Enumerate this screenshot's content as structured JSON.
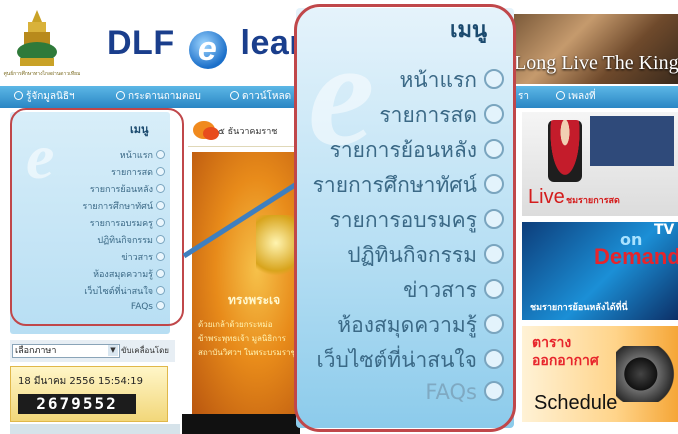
{
  "header": {
    "emblem_caption": "ศูนย์การศึกษาทางไกลผ่านดาวเทียม",
    "brand_prefix": "DLF",
    "brand_e": "e",
    "brand_suffix": "learni",
    "banner_text": "Long Live The King"
  },
  "topnav": {
    "items": [
      "รู้จักมูลนิธิฯ",
      "กระดานถามตอบ",
      "ดาวน์โหลด",
      "รา",
      "เพลงที่"
    ]
  },
  "sidebar": {
    "title": "เมนู",
    "items": [
      "หน้าแรก",
      "รายการสด",
      "รายการย้อนหลัง",
      "รายการศึกษาทัศน์",
      "รายการอบรมครู",
      "ปฏิทินกิจกรรม",
      "ข่าวสาร",
      "ห้องสมุดความรู้",
      "เว็บไซต์ที่น่าสนใจ",
      "FAQs"
    ]
  },
  "language": {
    "selected": "เลือกภาษา",
    "slide_text": "ขับเคลื่อนโดย"
  },
  "clock": {
    "datetime": "18 มีนาคม 2556  15:54:19",
    "counter": "2679552"
  },
  "middle": {
    "title": "๕ ธันวาคมราช",
    "poster_caption": "ทรงพระเจ",
    "poster_line1": "ด้วยเกล้าด้วยกระหม่อ",
    "poster_line2": "ข้าพระพุทธเจ้า มูลนิธิการ",
    "poster_line3": "สถาบันวิศวฯ ในพระบรมราชู"
  },
  "zoom_menu": {
    "title": "เมนู",
    "items": [
      "หน้าแรก",
      "รายการสด",
      "รายการย้อนหลัง",
      "รายการศึกษาทัศน์",
      "รายการอบรมครู",
      "ปฏิทินกิจกรรม",
      "ข่าวสาร",
      "ห้องสมุดความรู้",
      "เว็บไซต์ที่น่าสนใจ",
      "FAQs"
    ]
  },
  "right": {
    "live_label": "Live",
    "live_sub": "ชมรายการสด",
    "demand_on": "on",
    "demand_tv": "TV",
    "demand_label": "Demand",
    "demand_sub": "ชมรายการย้อนหลังได้ที่นี่",
    "sched_title1": "ตาราง",
    "sched_title2": "ออกอากาศ",
    "sched_label": "Schedule"
  },
  "colors": {
    "accent_red": "#c0474a",
    "nav_blue": "#2a86c4",
    "menu_text": "#3b6986"
  }
}
